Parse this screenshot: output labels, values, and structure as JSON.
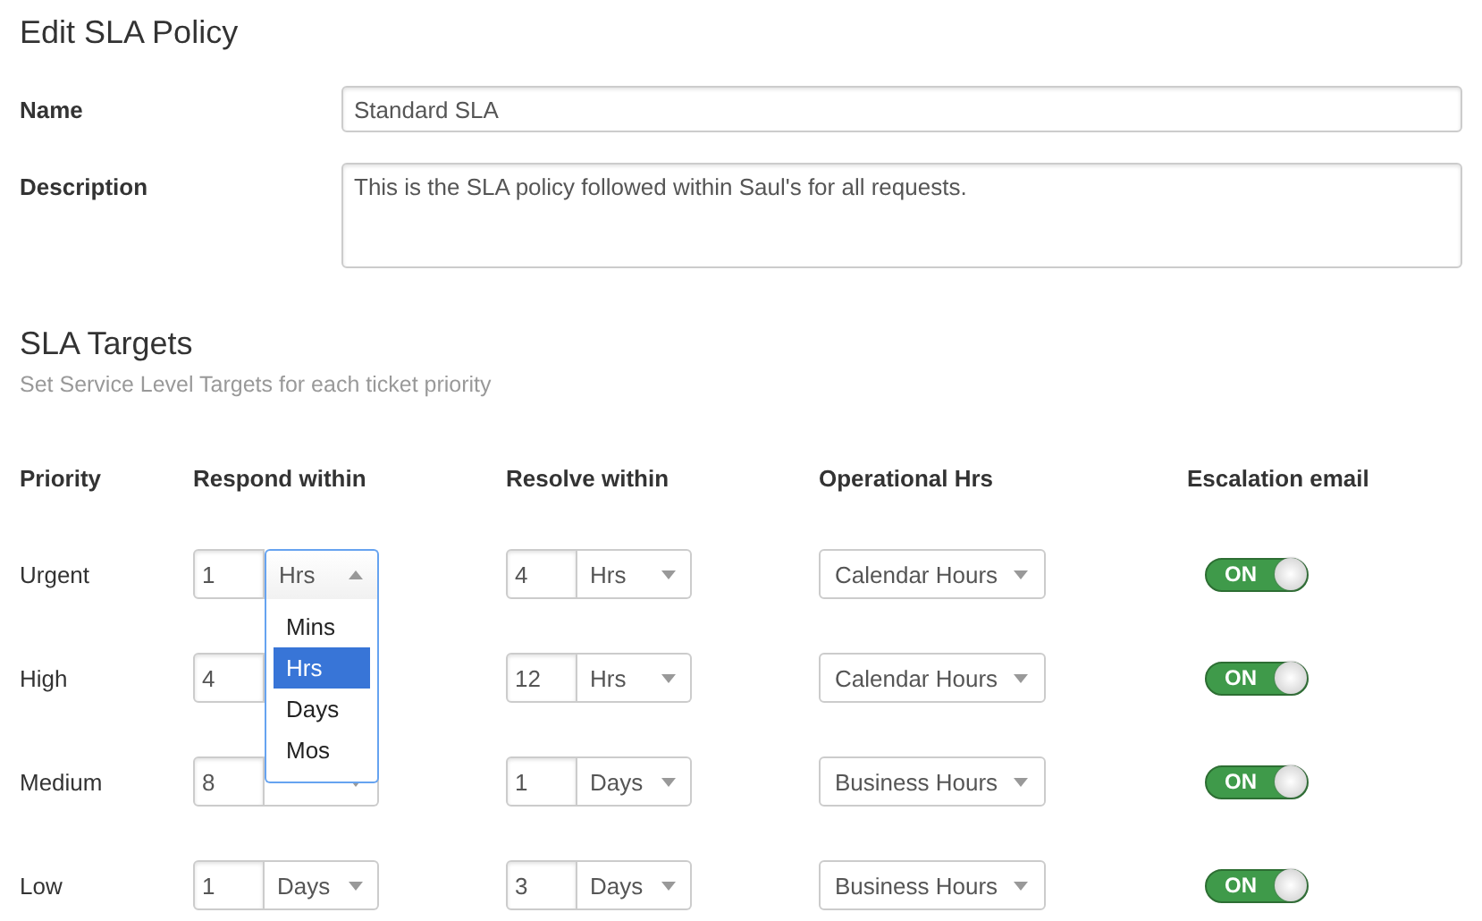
{
  "title": "Edit SLA Policy",
  "fields": [
    {
      "kind": "text",
      "label": "Name",
      "value": "Standard SLA"
    },
    {
      "kind": "textarea",
      "label": "Description",
      "value": "This is the SLA policy followed within Saul's for all requests."
    }
  ],
  "targets": {
    "title": "SLA Targets",
    "subtitle": "Set Service Level Targets for each ticket priority",
    "columns": [
      "Priority",
      "Respond within",
      "Resolve within",
      "Operational Hrs",
      "Escalation email"
    ],
    "rows": [
      {
        "priority": "Urgent",
        "respond": {
          "value": "1",
          "unit": "Hrs",
          "expanded": true,
          "options": [
            {
              "label": "Mins",
              "selected": false
            },
            {
              "label": "Hrs",
              "selected": true
            },
            {
              "label": "Days",
              "selected": false
            },
            {
              "label": "Mos",
              "selected": false
            }
          ]
        },
        "resolve": {
          "value": "4",
          "unit": "Hrs",
          "expanded": false
        },
        "operational_hrs": "Calendar Hours",
        "escalation_email": {
          "label": "ON",
          "on": true
        }
      },
      {
        "priority": "High",
        "respond": {
          "value": "4",
          "expanded": false
        },
        "resolve": {
          "value": "12",
          "unit": "Hrs",
          "expanded": false
        },
        "operational_hrs": "Calendar Hours",
        "escalation_email": {
          "label": "ON",
          "on": true
        }
      },
      {
        "priority": "Medium",
        "respond": {
          "value": "8",
          "expanded": false
        },
        "resolve": {
          "value": "1",
          "unit": "Days",
          "expanded": false
        },
        "operational_hrs": "Business Hours",
        "escalation_email": {
          "label": "ON",
          "on": true
        }
      },
      {
        "priority": "Low",
        "respond": {
          "value": "1",
          "unit": "Days",
          "expanded": false
        },
        "resolve": {
          "value": "3",
          "unit": "Days",
          "expanded": false
        },
        "operational_hrs": "Business Hours",
        "escalation_email": {
          "label": "ON",
          "on": true
        }
      }
    ]
  }
}
